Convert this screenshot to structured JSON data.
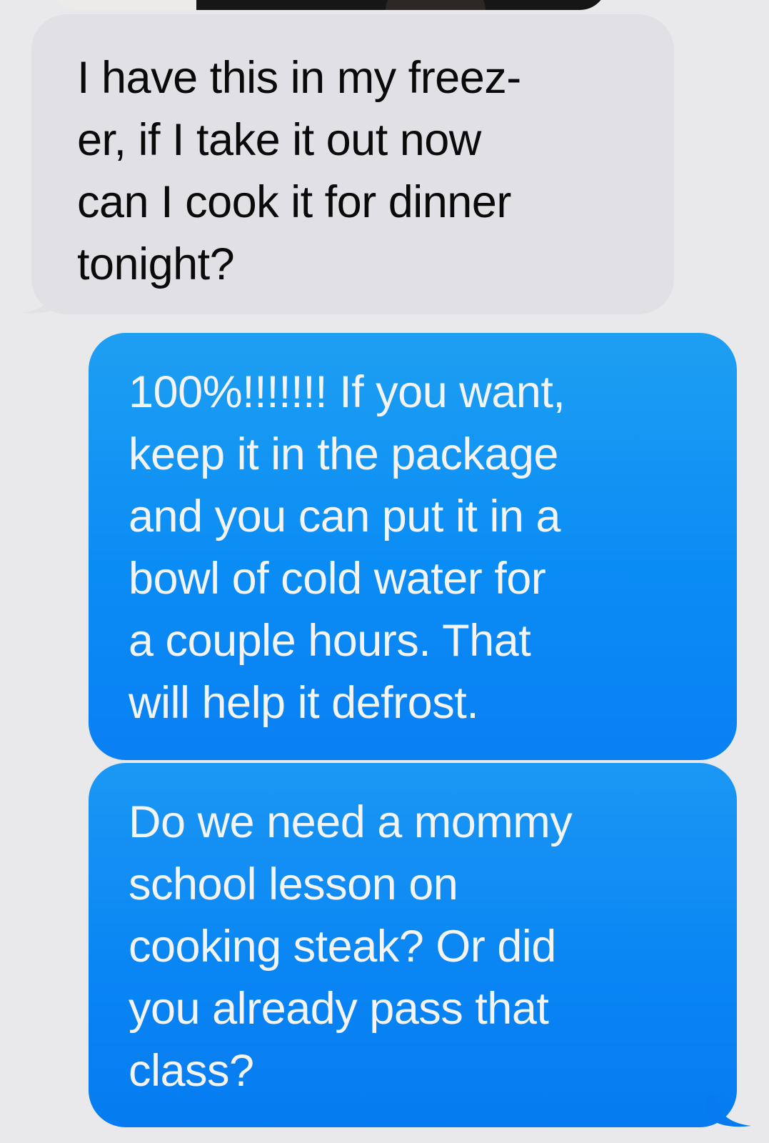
{
  "messages": [
    {
      "direction": "received",
      "text": "I have this in my freez-\ner, if I take it out now\ncan I cook it for dinner\ntonight?"
    },
    {
      "direction": "sent",
      "text": "100%!!!!!!! If you want,\nkeep it in the package\nand you can put it in a\nbowl of cold water for\na couple hours. That\nwill help it defrost."
    },
    {
      "direction": "sent",
      "text": "Do we need a mommy\nschool lesson on\ncooking steak?  Or did\nyou already pass that\nclass?"
    }
  ],
  "colors": {
    "background": "#e9e9eb",
    "received_bubble": "#e1e0e5",
    "received_text": "#0a0a0a",
    "sent_bubble": "#0a8cf5",
    "sent_text": "#f4f4f4"
  }
}
